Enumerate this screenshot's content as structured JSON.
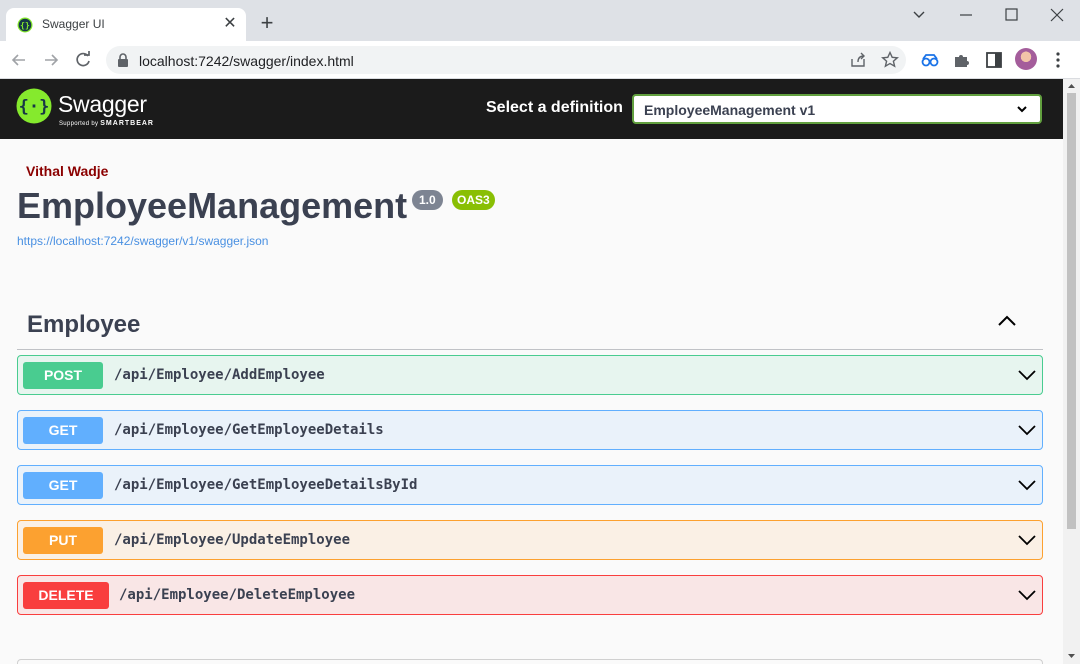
{
  "browser": {
    "tab_title": "Swagger UI",
    "url": "localhost:7242/swagger/index.html"
  },
  "swagger": {
    "brand": "Swagger",
    "supported_by": "Supported by",
    "smartbear": "SMARTBEAR",
    "definition_label": "Select a definition",
    "definition_value": "EmployeeManagement v1"
  },
  "info": {
    "author": "Vithal Wadje",
    "title": "EmployeeManagement",
    "version": "1.0",
    "oas": "OAS3",
    "spec_url": "https://localhost:7242/swagger/v1/swagger.json"
  },
  "tag": {
    "name": "Employee"
  },
  "operations": [
    {
      "method": "POST",
      "path": "/api/Employee/AddEmployee"
    },
    {
      "method": "GET",
      "path": "/api/Employee/GetEmployeeDetails"
    },
    {
      "method": "GET",
      "path": "/api/Employee/GetEmployeeDetailsById"
    },
    {
      "method": "PUT",
      "path": "/api/Employee/UpdateEmployee"
    },
    {
      "method": "DELETE",
      "path": "/api/Employee/DeleteEmployee"
    }
  ],
  "colors": {
    "post": "#49cc90",
    "get": "#61affe",
    "put": "#fca130",
    "delete": "#f93e3e",
    "topbar": "#1b1b1b",
    "swagger_green": "#85ea2d"
  },
  "icons": [
    "swagger-logo-icon",
    "lock-icon",
    "share-icon",
    "star-icon",
    "extension-icon",
    "puzzle-icon",
    "sidepanel-icon",
    "chevron-down-icon",
    "chevron-up-icon"
  ]
}
